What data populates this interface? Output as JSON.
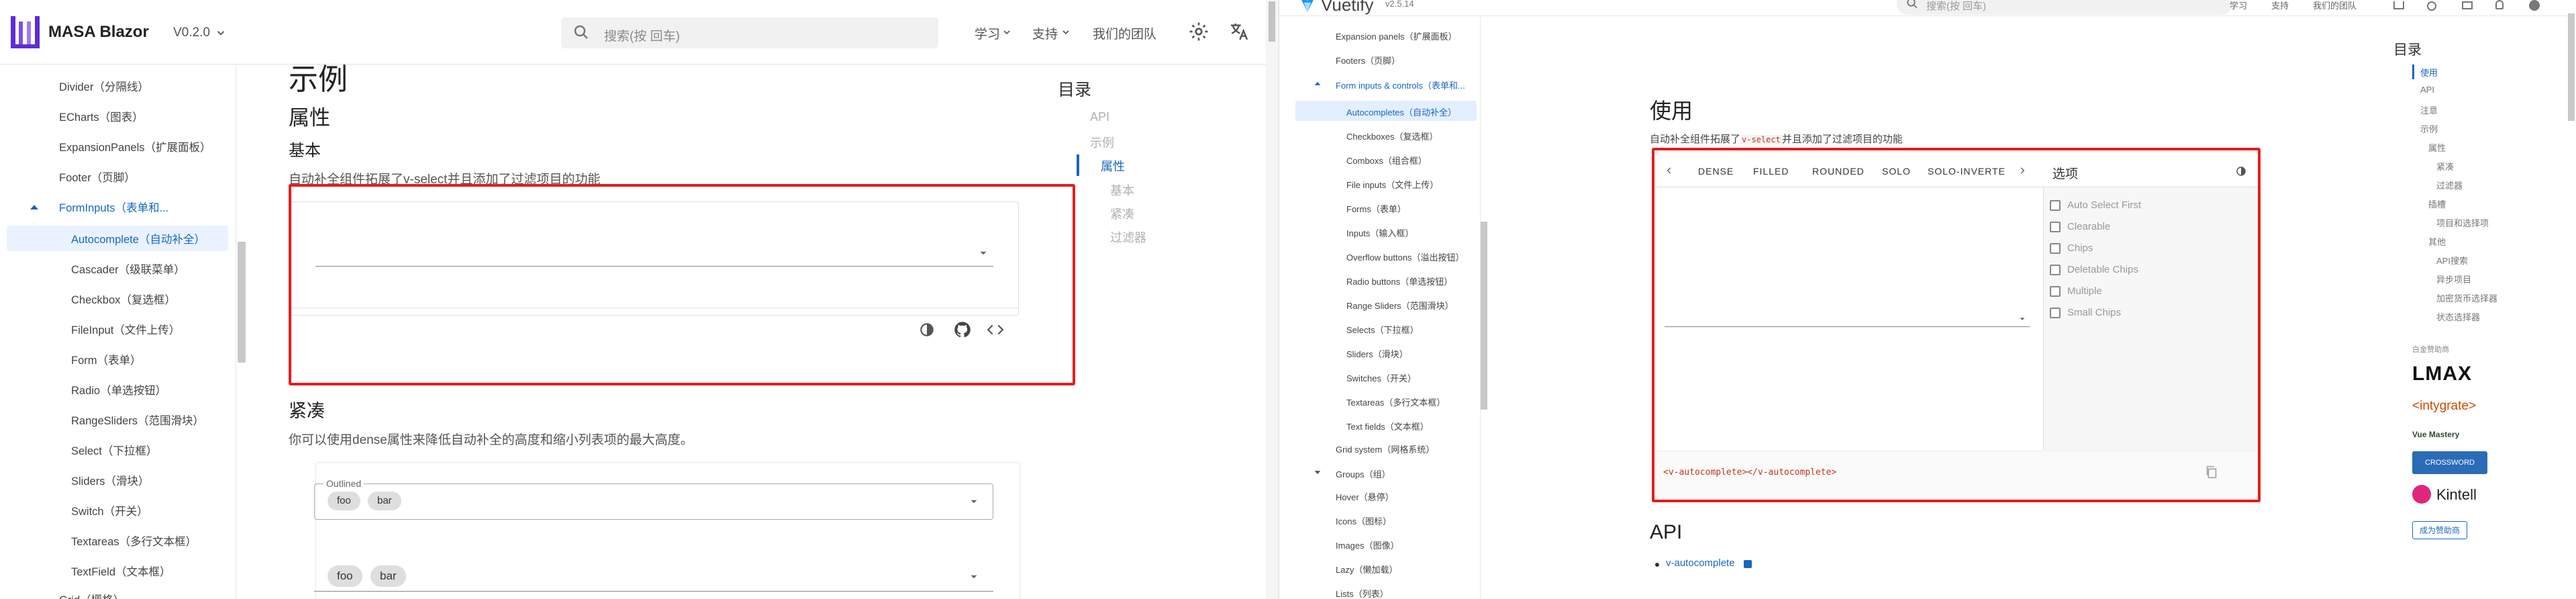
{
  "left": {
    "brand": "MASA Blazor",
    "version": "V0.2.0",
    "search_placeholder": "搜索(按 回车)",
    "nav": [
      "学习",
      "支持",
      "我们的团队"
    ],
    "sidebar": {
      "items": [
        {
          "label": "Divider（分隔线）",
          "indent": "child"
        },
        {
          "label": "ECharts（图表）",
          "indent": "child"
        },
        {
          "label": "ExpansionPanels（扩展面板）",
          "indent": "child"
        },
        {
          "label": "Footer（页脚）",
          "indent": "child"
        },
        {
          "label": "FormInputs（表单和...",
          "indent": "group",
          "expanded": true
        },
        {
          "label": "Autocomplete（自动补全）",
          "indent": "sub",
          "active": true
        },
        {
          "label": "Cascader（级联菜单）",
          "indent": "sub"
        },
        {
          "label": "Checkbox（复选框）",
          "indent": "sub"
        },
        {
          "label": "FileInput（文件上传）",
          "indent": "sub"
        },
        {
          "label": "Form（表单）",
          "indent": "sub"
        },
        {
          "label": "Radio（单选按钮）",
          "indent": "sub"
        },
        {
          "label": "RangeSliders（范围滑块）",
          "indent": "sub"
        },
        {
          "label": "Select（下拉框）",
          "indent": "sub"
        },
        {
          "label": "Sliders（滑块）",
          "indent": "sub"
        },
        {
          "label": "Switch（开关）",
          "indent": "sub"
        },
        {
          "label": "Textareas（多行文本框）",
          "indent": "sub"
        },
        {
          "label": "TextField（文本框）",
          "indent": "sub"
        },
        {
          "label": "Grid（栅格）",
          "indent": "child"
        }
      ]
    },
    "content": {
      "h1": "示例",
      "h2": "属性",
      "h3_basic": "基本",
      "basic_desc": "自动补全组件拓展了v-select并且添加了过滤项目的功能",
      "h3_dense": "紧凑",
      "dense_desc": "你可以使用dense属性来降低自动补全的高度和缩小列表项的最大高度。",
      "outlined_label": "Outlined",
      "chips": [
        "foo",
        "bar"
      ]
    },
    "toc": {
      "title": "目录",
      "items": [
        "API",
        "示例",
        "属性",
        "基本",
        "紧凑",
        "过滤器"
      ],
      "active": "属性"
    }
  },
  "right": {
    "brand": "Vuetify",
    "version": "v2.5.14",
    "search_placeholder": "搜索(按 回车)",
    "nav": [
      "学习",
      "支持",
      "我们的团队"
    ],
    "sidebar": {
      "items": [
        {
          "label": "Expansion panels（扩展面板）",
          "indent": "sub"
        },
        {
          "label": "Footers（页脚）",
          "indent": "sub"
        },
        {
          "label": "Form inputs & controls（表单和...",
          "indent": "group",
          "expanded": true
        },
        {
          "label": "Autocompletes（自动补全）",
          "indent": "sub2",
          "active": true
        },
        {
          "label": "Checkboxes（复选框）",
          "indent": "sub2"
        },
        {
          "label": "Comboxs（组合框）",
          "indent": "sub2"
        },
        {
          "label": "File inputs（文件上传）",
          "indent": "sub2"
        },
        {
          "label": "Forms（表单）",
          "indent": "sub2"
        },
        {
          "label": "Inputs（输入框）",
          "indent": "sub2"
        },
        {
          "label": "Overflow buttons（溢出按钮）",
          "indent": "sub2"
        },
        {
          "label": "Radio buttons（单选按钮）",
          "indent": "sub2"
        },
        {
          "label": "Range Sliders（范围滑块）",
          "indent": "sub2"
        },
        {
          "label": "Selects（下拉框）",
          "indent": "sub2"
        },
        {
          "label": "Sliders（滑块）",
          "indent": "sub2"
        },
        {
          "label": "Switches（开关）",
          "indent": "sub2"
        },
        {
          "label": "Textareas（多行文本框）",
          "indent": "sub2"
        },
        {
          "label": "Text fields（文本框）",
          "indent": "sub2"
        },
        {
          "label": "Grid system（网格系统）",
          "indent": "sub"
        },
        {
          "label": "Groups（组）",
          "indent": "group",
          "expanded": false
        },
        {
          "label": "Hover（悬停）",
          "indent": "sub"
        },
        {
          "label": "Icons（图标）",
          "indent": "sub"
        },
        {
          "label": "Images（图像）",
          "indent": "sub"
        },
        {
          "label": "Lazy（懒加载）",
          "indent": "sub"
        },
        {
          "label": "Lists（列表）",
          "indent": "sub"
        }
      ]
    },
    "content": {
      "h2_usage": "使用",
      "usage_desc_pre": "自动补全组件拓展了",
      "usage_desc_code": "v-select",
      "usage_desc_post": "并且添加了过滤项目的功能",
      "tabs": [
        "DENSE",
        "FILLED",
        "ROUNDED",
        "SOLO",
        "SOLO-INVERTE"
      ],
      "options_title": "选项",
      "options": [
        "Auto Select First",
        "Clearable",
        "Chips",
        "Deletable Chips",
        "Multiple",
        "Small Chips"
      ],
      "code_open": "<v-autocomplete>",
      "code_close": "</v-autocomplete>",
      "h2_api": "API",
      "api_link": "v-autocomplete"
    },
    "toc": {
      "title": "目录",
      "items": [
        {
          "label": "使用",
          "level": 0,
          "active": true
        },
        {
          "label": "API",
          "level": 0
        },
        {
          "label": "注意",
          "level": 0
        },
        {
          "label": "示例",
          "level": 0
        },
        {
          "label": "属性",
          "level": 1
        },
        {
          "label": "紧凑",
          "level": 2
        },
        {
          "label": "过滤器",
          "level": 2
        },
        {
          "label": "插槽",
          "level": 1
        },
        {
          "label": "项目和选择项",
          "level": 2
        },
        {
          "label": "其他",
          "level": 1
        },
        {
          "label": "API搜索",
          "level": 2
        },
        {
          "label": "异步项目",
          "level": 2
        },
        {
          "label": "加密货币选择器",
          "level": 2
        },
        {
          "label": "状态选择器",
          "level": 2
        }
      ],
      "sponsors_label": "白金赞助商",
      "sponsors": [
        "LMAX",
        "<intygrate>",
        "Vue Mastery",
        "CROSSWORD SOLVER",
        "Kintell"
      ],
      "become_sponsor": "成为赞助商"
    }
  },
  "colors": {
    "primary": "#1867c0",
    "highlight": "#e41d1d",
    "brand_purple": "#5c2dd5",
    "vue_green": "#42b883"
  }
}
